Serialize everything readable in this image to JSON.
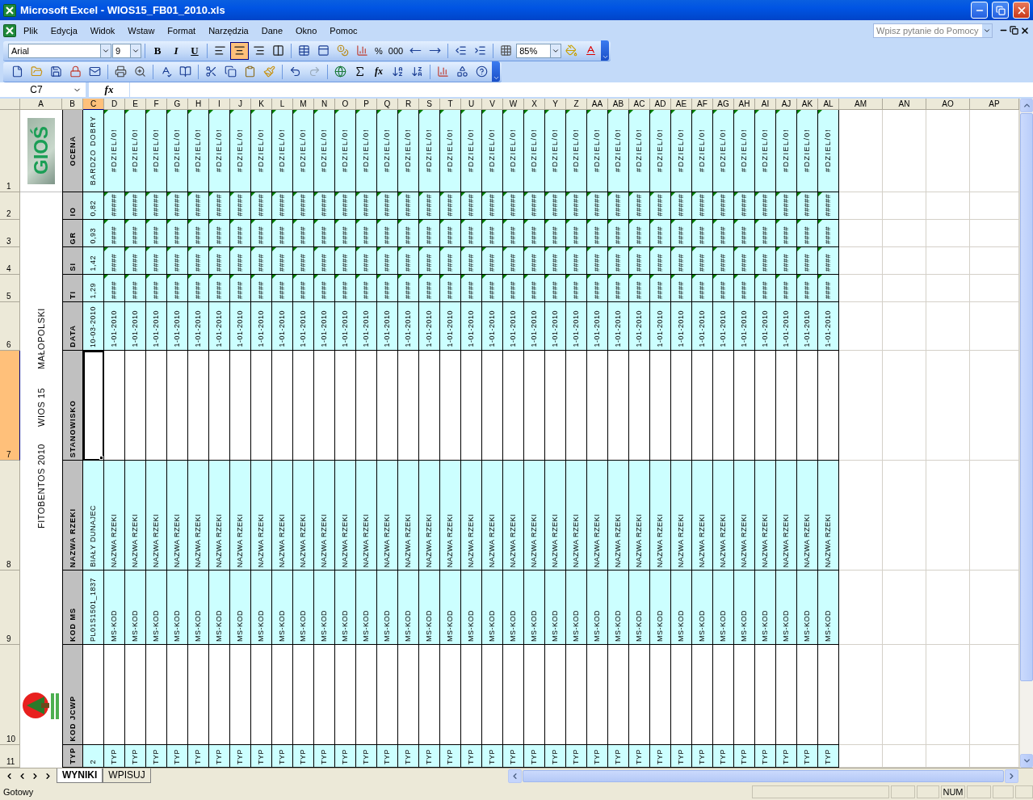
{
  "window": {
    "title": "Microsoft Excel - WIOS15_FB01_2010.xls"
  },
  "menu": [
    "Plik",
    "Edycja",
    "Widok",
    "Wstaw",
    "Format",
    "Narzędzia",
    "Dane",
    "Okno",
    "Pomoc"
  ],
  "help_box": {
    "placeholder": "Wpisz pytanie do Pomocy"
  },
  "formatting": {
    "font": "Arial",
    "size": "9",
    "style_buttons": [
      {
        "label": "B"
      },
      {
        "label": "I"
      },
      {
        "label": "U"
      }
    ],
    "align": [
      {
        "selected": false
      },
      {
        "selected": true
      },
      {
        "selected": false
      },
      {
        "selected": false
      }
    ],
    "percent": "%",
    "thousands": "000",
    "zoom": "85%"
  },
  "formula_bar": {
    "name_box": "C7",
    "fx": "fx"
  },
  "standard_toolbar": {
    "function_button": "fx"
  },
  "columns": [
    {
      "label": "A",
      "selected": false
    },
    {
      "label": "B",
      "selected": false
    },
    {
      "label": "C",
      "selected": true
    },
    {
      "label": "D",
      "selected": false
    },
    {
      "label": "E",
      "selected": false
    },
    {
      "label": "F",
      "selected": false
    },
    {
      "label": "G",
      "selected": false
    },
    {
      "label": "H",
      "selected": false
    },
    {
      "label": "I",
      "selected": false
    },
    {
      "label": "J",
      "selected": false
    },
    {
      "label": "K",
      "selected": false
    },
    {
      "label": "L",
      "selected": false
    },
    {
      "label": "M",
      "selected": false
    },
    {
      "label": "N",
      "selected": false
    },
    {
      "label": "O",
      "selected": false
    },
    {
      "label": "P",
      "selected": false
    },
    {
      "label": "Q",
      "selected": false
    },
    {
      "label": "R",
      "selected": false
    },
    {
      "label": "S",
      "selected": false
    },
    {
      "label": "T",
      "selected": false
    },
    {
      "label": "U",
      "selected": false
    },
    {
      "label": "V",
      "selected": false
    },
    {
      "label": "W",
      "selected": false
    },
    {
      "label": "X",
      "selected": false
    },
    {
      "label": "Y",
      "selected": false
    },
    {
      "label": "Z",
      "selected": false
    },
    {
      "label": "AA",
      "selected": false
    },
    {
      "label": "AB",
      "selected": false
    },
    {
      "label": "AC",
      "selected": false
    },
    {
      "label": "AD",
      "selected": false
    },
    {
      "label": "AE",
      "selected": false
    },
    {
      "label": "AF",
      "selected": false
    },
    {
      "label": "AG",
      "selected": false
    },
    {
      "label": "AH",
      "selected": false
    },
    {
      "label": "AI",
      "selected": false
    },
    {
      "label": "AJ",
      "selected": false
    },
    {
      "label": "AK",
      "selected": false
    },
    {
      "label": "AL",
      "selected": false
    },
    {
      "label": "AM",
      "selected": false
    },
    {
      "label": "AN",
      "selected": false
    },
    {
      "label": "AO",
      "selected": false
    },
    {
      "label": "AP",
      "selected": false
    }
  ],
  "logo_top": {
    "text": "GIOŚ"
  },
  "side_texts": [
    "FITOBENTOS 2010",
    "WIOS 15",
    "MAŁOPOLSKI"
  ],
  "rows": [
    {
      "number": "1",
      "selected": false,
      "label": "OCENA",
      "shaded": true,
      "flagged": true,
      "cells": [
        "BARDZO DOBRY",
        "#DZIEL/0!",
        "#DZIEL/0!",
        "#DZIEL/0!",
        "#DZIEL/0!",
        "#DZIEL/0!",
        "#DZIEL/0!",
        "#DZIEL/0!",
        "#DZIEL/0!",
        "#DZIEL/0!",
        "#DZIEL/0!",
        "#DZIEL/0!",
        "#DZIEL/0!",
        "#DZIEL/0!",
        "#DZIEL/0!",
        "#DZIEL/0!",
        "#DZIEL/0!",
        "#DZIEL/0!",
        "#DZIEL/0!",
        "#DZIEL/0!",
        "#DZIEL/0!",
        "#DZIEL/0!",
        "#DZIEL/0!",
        "#DZIEL/0!",
        "#DZIEL/0!",
        "#DZIEL/0!",
        "#DZIEL/0!",
        "#DZIEL/0!",
        "#DZIEL/0!",
        "#DZIEL/0!",
        "#DZIEL/0!",
        "#DZIEL/0!",
        "#DZIEL/0!",
        "#DZIEL/0!",
        "#DZIEL/0!",
        "#DZIEL/0!"
      ]
    },
    {
      "number": "2",
      "selected": false,
      "label": "IO",
      "shaded": true,
      "flagged": true,
      "cells": [
        "0,82",
        "#####",
        "#####",
        "#####",
        "#####",
        "#####",
        "#####",
        "#####",
        "#####",
        "#####",
        "#####",
        "#####",
        "#####",
        "#####",
        "#####",
        "#####",
        "#####",
        "#####",
        "#####",
        "#####",
        "#####",
        "#####",
        "#####",
        "#####",
        "#####",
        "#####",
        "#####",
        "#####",
        "#####",
        "#####",
        "#####",
        "#####",
        "#####",
        "#####",
        "#####",
        "#####"
      ]
    },
    {
      "number": "3",
      "selected": false,
      "label": "GR",
      "shaded": true,
      "flagged": true,
      "cells": [
        "0,93",
        "####",
        "####",
        "####",
        "####",
        "####",
        "####",
        "####",
        "####",
        "####",
        "####",
        "####",
        "####",
        "####",
        "####",
        "####",
        "####",
        "####",
        "####",
        "####",
        "####",
        "####",
        "####",
        "####",
        "####",
        "####",
        "####",
        "####",
        "####",
        "####",
        "####",
        "####",
        "####",
        "####",
        "####",
        "####"
      ]
    },
    {
      "number": "4",
      "selected": false,
      "label": "SI",
      "shaded": true,
      "flagged": true,
      "cells": [
        "1,42",
        "####",
        "####",
        "####",
        "####",
        "####",
        "####",
        "####",
        "####",
        "####",
        "####",
        "####",
        "####",
        "####",
        "####",
        "####",
        "####",
        "####",
        "####",
        "####",
        "####",
        "####",
        "####",
        "####",
        "####",
        "####",
        "####",
        "####",
        "####",
        "####",
        "####",
        "####",
        "####",
        "####",
        "####",
        "####"
      ]
    },
    {
      "number": "5",
      "selected": false,
      "label": "TI",
      "shaded": true,
      "flagged": true,
      "cells": [
        "1,29",
        "####",
        "####",
        "####",
        "####",
        "####",
        "####",
        "####",
        "####",
        "####",
        "####",
        "####",
        "####",
        "####",
        "####",
        "####",
        "####",
        "####",
        "####",
        "####",
        "####",
        "####",
        "####",
        "####",
        "####",
        "####",
        "####",
        "####",
        "####",
        "####",
        "####",
        "####",
        "####",
        "####",
        "####",
        "####"
      ]
    },
    {
      "number": "6",
      "selected": false,
      "label": "DATA",
      "shaded": true,
      "cells": [
        "10-03-2010",
        "1-01-2010",
        "1-01-2010",
        "1-01-2010",
        "1-01-2010",
        "1-01-2010",
        "1-01-2010",
        "1-01-2010",
        "1-01-2010",
        "1-01-2010",
        "1-01-2010",
        "1-01-2010",
        "1-01-2010",
        "1-01-2010",
        "1-01-2010",
        "1-01-2010",
        "1-01-2010",
        "1-01-2010",
        "1-01-2010",
        "1-01-2010",
        "1-01-2010",
        "1-01-2010",
        "1-01-2010",
        "1-01-2010",
        "1-01-2010",
        "1-01-2010",
        "1-01-2010",
        "1-01-2010",
        "1-01-2010",
        "1-01-2010",
        "1-01-2010",
        "1-01-2010",
        "1-01-2010",
        "1-01-2010",
        "1-01-2010",
        "1-01-2010"
      ]
    },
    {
      "number": "7",
      "selected": true,
      "label": "STANOWISKO",
      "shaded": false
    },
    {
      "number": "8",
      "selected": false,
      "label": "NAZWA RZEKI",
      "shaded": true,
      "cells": [
        "BIAŁY DUNAJEC",
        "NAZWA RZEKI",
        "NAZWA RZEKI",
        "NAZWA RZEKI",
        "NAZWA RZEKI",
        "NAZWA RZEKI",
        "NAZWA RZEKI",
        "NAZWA RZEKI",
        "NAZWA RZEKI",
        "NAZWA RZEKI",
        "NAZWA RZEKI",
        "NAZWA RZEKI",
        "NAZWA RZEKI",
        "NAZWA RZEKI",
        "NAZWA RZEKI",
        "NAZWA RZEKI",
        "NAZWA RZEKI",
        "NAZWA RZEKI",
        "NAZWA RZEKI",
        "NAZWA RZEKI",
        "NAZWA RZEKI",
        "NAZWA RZEKI",
        "NAZWA RZEKI",
        "NAZWA RZEKI",
        "NAZWA RZEKI",
        "NAZWA RZEKI",
        "NAZWA RZEKI",
        "NAZWA RZEKI",
        "NAZWA RZEKI",
        "NAZWA RZEKI",
        "NAZWA RZEKI",
        "NAZWA RZEKI",
        "NAZWA RZEKI",
        "NAZWA RZEKI",
        "NAZWA RZEKI",
        "NAZWA RZEKI"
      ]
    },
    {
      "number": "9",
      "selected": false,
      "label": "KOD MS",
      "shaded": true,
      "cells": [
        "PL01S1501_1837",
        "MS-KOD",
        "MS-KOD",
        "MS-KOD",
        "MS-KOD",
        "MS-KOD",
        "MS-KOD",
        "MS-KOD",
        "MS-KOD",
        "MS-KOD",
        "MS-KOD",
        "MS-KOD",
        "MS-KOD",
        "MS-KOD",
        "MS-KOD",
        "MS-KOD",
        "MS-KOD",
        "MS-KOD",
        "MS-KOD",
        "MS-KOD",
        "MS-KOD",
        "MS-KOD",
        "MS-KOD",
        "MS-KOD",
        "MS-KOD",
        "MS-KOD",
        "MS-KOD",
        "MS-KOD",
        "MS-KOD",
        "MS-KOD",
        "MS-KOD",
        "MS-KOD",
        "MS-KOD",
        "MS-KOD",
        "MS-KOD",
        "MS-KOD"
      ]
    },
    {
      "number": "10",
      "selected": false,
      "label": "KOD JCWP",
      "shaded": false
    },
    {
      "number": "11",
      "selected": false,
      "label": "TYP",
      "shaded": true,
      "cells": [
        "2",
        "TYP",
        "TYP",
        "TYP",
        "TYP",
        "TYP",
        "TYP",
        "TYP",
        "TYP",
        "TYP",
        "TYP",
        "TYP",
        "TYP",
        "TYP",
        "TYP",
        "TYP",
        "TYP",
        "TYP",
        "TYP",
        "TYP",
        "TYP",
        "TYP",
        "TYP",
        "TYP",
        "TYP",
        "TYP",
        "TYP",
        "TYP",
        "TYP",
        "TYP",
        "TYP",
        "TYP",
        "TYP",
        "TYP",
        "TYP",
        "TYP"
      ]
    }
  ],
  "sheet_tabs": [
    {
      "label": "WYNIKI",
      "selected": true
    },
    {
      "label": "WPISUJ",
      "selected": false
    }
  ],
  "status_bar": {
    "text": "Gotowy",
    "indicators": [
      "NUM"
    ]
  }
}
